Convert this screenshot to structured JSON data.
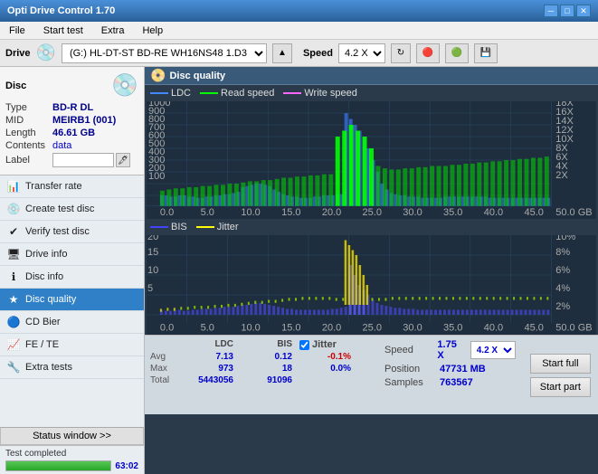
{
  "titleBar": {
    "title": "Opti Drive Control 1.70",
    "minimize": "─",
    "maximize": "□",
    "close": "✕"
  },
  "menuBar": {
    "items": [
      "File",
      "Start test",
      "Extra",
      "Help"
    ]
  },
  "driveBar": {
    "driveLabel": "Drive",
    "driveValue": "(G:) HL-DT-ST BD-RE  WH16NS48 1.D3",
    "speedLabel": "Speed",
    "speedValue": "4.2 X"
  },
  "discInfo": {
    "typeLabel": "Type",
    "typeValue": "BD-R DL",
    "midLabel": "MID",
    "midValue": "MEIRB1 (001)",
    "lengthLabel": "Length",
    "lengthValue": "46.61 GB",
    "contentsLabel": "Contents",
    "contentsValue": "data",
    "labelLabel": "Label",
    "labelValue": ""
  },
  "navItems": [
    {
      "id": "transfer-rate",
      "label": "Transfer rate",
      "icon": "📊"
    },
    {
      "id": "create-test-disc",
      "label": "Create test disc",
      "icon": "💿"
    },
    {
      "id": "verify-test-disc",
      "label": "Verify test disc",
      "icon": "✔"
    },
    {
      "id": "drive-info",
      "label": "Drive info",
      "icon": "🖥"
    },
    {
      "id": "disc-info",
      "label": "Disc info",
      "icon": "ℹ"
    },
    {
      "id": "disc-quality",
      "label": "Disc quality",
      "icon": "★",
      "active": true
    },
    {
      "id": "cd-bier",
      "label": "CD Bier",
      "icon": "🔵"
    },
    {
      "id": "fe-te",
      "label": "FE / TE",
      "icon": "📈"
    },
    {
      "id": "extra-tests",
      "label": "Extra tests",
      "icon": "🔧"
    }
  ],
  "statusWindowBtn": "Status window >>",
  "statusText": "Test completed",
  "progressPercent": 100,
  "progressWidth": "100%",
  "progressValue": "63:02",
  "chartTitle": "Disc quality",
  "legend": {
    "ldc": "LDC",
    "read": "Read speed",
    "write": "Write speed"
  },
  "legend2": {
    "bis": "BIS",
    "jitter": "Jitter"
  },
  "chart1": {
    "yMax": 1000,
    "yLabel": "1000",
    "yRight1": "18X",
    "yRight2": "16X",
    "yRight3": "14X",
    "yRight4": "12X",
    "yRight5": "10X",
    "yRight6": "8X",
    "yRight7": "6X",
    "yRight8": "4X",
    "yRight9": "2X"
  },
  "chart2": {
    "yRight1": "10%",
    "yRight2": "8%",
    "yRight3": "6%",
    "yRight4": "4%",
    "yRight5": "2%"
  },
  "stats": {
    "headers": [
      "LDC",
      "BIS",
      "",
      "Jitter",
      "Speed",
      ""
    ],
    "avgLabel": "Avg",
    "avgLdc": "7.13",
    "avgBis": "0.12",
    "avgJitter": "-0.1%",
    "maxLabel": "Max",
    "maxLdc": "973",
    "maxBis": "18",
    "maxJitter": "0.0%",
    "totalLabel": "Total",
    "totalLdc": "5443056",
    "totalBis": "91096",
    "speedLabel": "Speed",
    "speedValue": "1.75 X",
    "speedDropdown": "4.2 X",
    "positionLabel": "Position",
    "positionValue": "47731 MB",
    "samplesLabel": "Samples",
    "samplesValue": "763567",
    "startFullBtn": "Start full",
    "startPartBtn": "Start part"
  },
  "jitterChecked": true,
  "jitterLabel": "Jitter"
}
